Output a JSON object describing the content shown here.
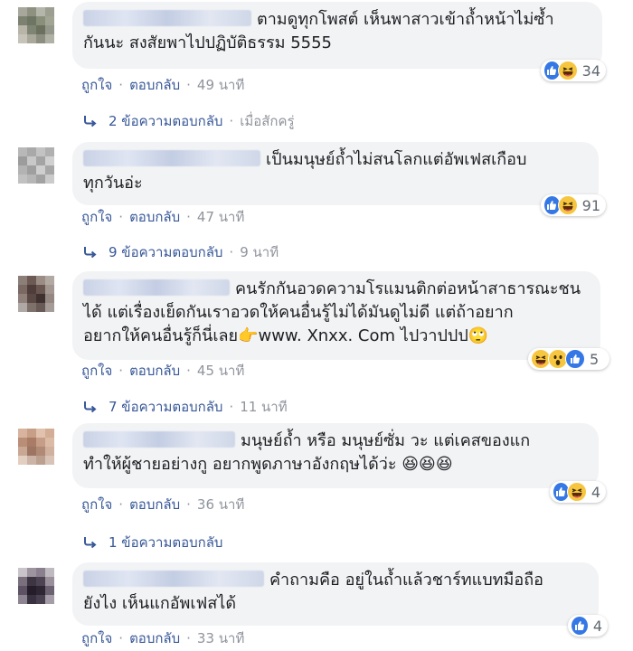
{
  "actions": {
    "like_label": "ถูกใจ",
    "reply_label": "ตอบกลับ",
    "separator": "·"
  },
  "colors": {
    "link": "#385898",
    "meta": "#90949c",
    "bubble": "#f2f3f5",
    "like": "#3578e5",
    "haha": "#f7c640"
  },
  "comments": [
    {
      "text": "ตามดูทุกโพสต์ เห็นพาสาวเข้าถ้ำหน้าไม่ซ้ำ\nกันนะ สงสัยพาไปปฏิบัติธรรม 5555",
      "reactions": [
        "like-icon",
        "haha-icon"
      ],
      "reaction_count": "34",
      "time": "49 นาที",
      "replies_label": "2 ข้อความตอบกลับ",
      "replies_time": "เมื่อสักครู่"
    },
    {
      "text": "เป็นมนุษย์ถ้ำไม่สนโลกแต่อัพเฟสเกือบ\nทุกวันอ่ะ",
      "reactions": [
        "like-icon",
        "haha-icon"
      ],
      "reaction_count": "91",
      "time": "47 นาที",
      "replies_label": "9 ข้อความตอบกลับ",
      "replies_time": "9 นาที"
    },
    {
      "text": "คนรักกันอวดความโรแมนติกต่อหน้าสาธารณะชน\nได้ แต่เรื่องเย็ดกันเราอวดให้คนอื่นรู้ไม่ได้มันดูไม่ดี แต่ถ้าอยาก\nอยากให้คนอื่นรู้ก็นี่เลย👉www. Xnxx. Com ไปวาปปป🙄",
      "reactions": [
        "haha-icon",
        "wow-icon",
        "like-icon"
      ],
      "reaction_count": "5",
      "time": "45 นาที",
      "replies_label": "7 ข้อความตอบกลับ",
      "replies_time": "11 นาที"
    },
    {
      "text": "มนุษย์ถ้ำ หรือ มนุษย์ซั่ม วะ แต่เคสของแก\nทำให้ผู้ชายอย่างกู อยากพูดภาษาอังกฤษได้ว่ะ 😆😆😆",
      "reactions": [
        "like-icon",
        "haha-icon"
      ],
      "reaction_count": "4",
      "time": "36 นาที",
      "replies_label": "1 ข้อความตอบกลับ",
      "replies_time": ""
    },
    {
      "text": "คำถามคือ อยู่ในถ้ำแล้วชาร์ทแบทมือถือ\nยังไง เห็นแกอัพเฟสได้",
      "reactions": [
        "like-icon"
      ],
      "reaction_count": "4",
      "time": "33 นาที",
      "replies_label": "",
      "replies_time": ""
    }
  ]
}
